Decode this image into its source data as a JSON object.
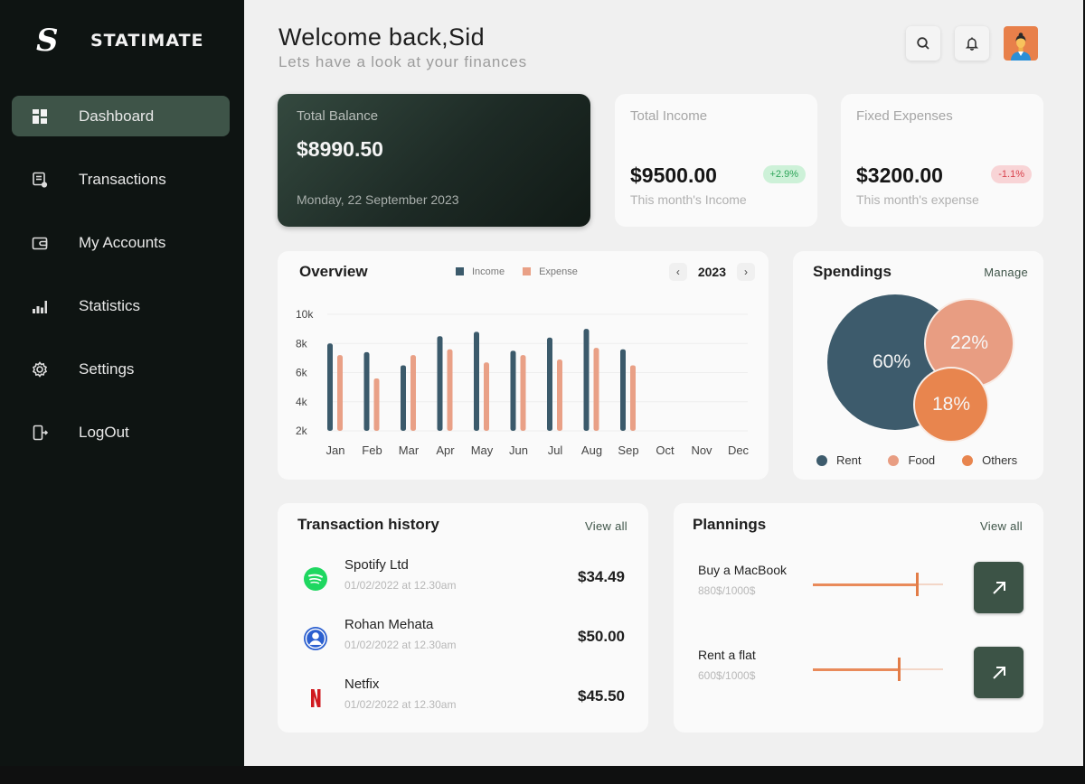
{
  "app": {
    "brand": "STATIMATE",
    "brand_mark": "S"
  },
  "sidebar": {
    "items": [
      {
        "label": "Dashboard",
        "icon": "grid-icon",
        "active": true
      },
      {
        "label": "Transactions",
        "icon": "receipt-icon",
        "active": false
      },
      {
        "label": "My  Accounts",
        "icon": "wallet-icon",
        "active": false
      },
      {
        "label": "Statistics",
        "icon": "bar-chart-icon",
        "active": false
      },
      {
        "label": "Settings",
        "icon": "gear-icon",
        "active": false
      },
      {
        "label": "LogOut",
        "icon": "logout-icon",
        "active": false
      }
    ]
  },
  "header": {
    "title": "Welcome  back,Sid",
    "subtitle": "Lets have a look at your finances",
    "actions": [
      "search-icon",
      "bell-icon",
      "avatar"
    ]
  },
  "balance_card": {
    "label": "Total Balance",
    "amount": "$8990.50",
    "date": "Monday, 22 September 2023"
  },
  "income_card": {
    "label": "Total Income",
    "amount": "$9500.00",
    "change": "+2.9%",
    "caption": "This month's Income"
  },
  "expense_card": {
    "label": "Fixed Expenses",
    "amount": "$3200.00",
    "change": "-1.1%",
    "caption": "This month's expense"
  },
  "overview": {
    "title": "Overview",
    "year": "2023",
    "prev_label": "‹",
    "next_label": "›"
  },
  "chart_data": [
    {
      "type": "bar",
      "title": "Overview",
      "categories": [
        "Jan",
        "Feb",
        "Mar",
        "Apr",
        "May",
        "Jun",
        "Jul",
        "Aug",
        "Sep",
        "Oct",
        "Nov",
        "Dec"
      ],
      "series": [
        {
          "name": "Income",
          "color": "#3b5a6b",
          "values": [
            8.0,
            7.4,
            6.5,
            8.5,
            8.8,
            7.5,
            8.4,
            9.0,
            7.6,
            null,
            null,
            null
          ]
        },
        {
          "name": "Expense",
          "color": "#e9a086",
          "values": [
            7.2,
            5.6,
            7.2,
            7.6,
            6.7,
            7.2,
            6.9,
            7.7,
            6.5,
            null,
            null,
            null
          ]
        }
      ],
      "unit": "k",
      "yticks": [
        2,
        4,
        6,
        8,
        10
      ],
      "ytick_labels": [
        "2k",
        "4k",
        "6k",
        "8k",
        "10k"
      ],
      "ylim": [
        2,
        10
      ],
      "xlabel": "",
      "ylabel": "",
      "grid": true,
      "legend": "top-center"
    },
    {
      "type": "pie",
      "title": "Spendings",
      "style": "bubble",
      "labels": [
        "Rent",
        "Food",
        "Others"
      ],
      "values": [
        60,
        22,
        18
      ],
      "value_labels": [
        "60%",
        "22%",
        "18%"
      ],
      "colors": [
        "#3d5b6c",
        "#e89d82",
        "#e8854e"
      ],
      "legend": "bottom"
    }
  ],
  "spendings": {
    "title": "Spendings",
    "manage_label": "Manage"
  },
  "transactions": {
    "title": "Transaction history",
    "view_all": "View  all",
    "items": [
      {
        "name": "Spotify Ltd",
        "date": "01/02/2022 at 12.30am",
        "amount": "$34.49",
        "icon": "spotify-icon"
      },
      {
        "name": "Rohan Mehata",
        "date": "01/02/2022 at 12.30am",
        "amount": "$50.00",
        "icon": "user-icon"
      },
      {
        "name": "Netfix",
        "date": "01/02/2022 at 12.30am",
        "amount": "$45.50",
        "icon": "netflix-icon"
      }
    ]
  },
  "plannings": {
    "title": "Plannings",
    "view_all": "View  all",
    "items": [
      {
        "name": "Buy a MacBook",
        "progress_text": "880$/1000$",
        "progress": 0.8
      },
      {
        "name": "Rent a flat",
        "progress_text": "600$/1000$",
        "progress": 0.66
      }
    ]
  }
}
